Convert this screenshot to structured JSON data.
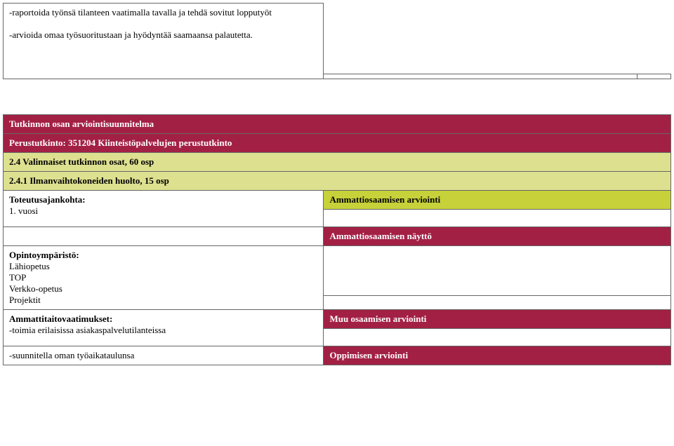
{
  "topLeft": {
    "line1": "-raportoida työnsä tilanteen vaatimalla tavalla ja tehdä sovitut lopputyöt",
    "line2": "-arvioida omaa työsuoritustaan ja hyödyntää saamaansa palautetta."
  },
  "section": {
    "header1": "Tutkinnon osan arviointisuunnitelma",
    "header2": "Perustutkinto: 351204 Kiinteistöpalvelujen  perustutkinto",
    "row1": "2.4 Valinnaiset tutkinnon osat, 60 osp",
    "row2": "2.4.1 Ilmanvaihtokoneiden huolto, 15 osp",
    "toteutusLabel": "Toteutusajankohta:",
    "toteutusValue": "1. vuosi",
    "ammattiOsa": "Ammattiosaamisen arviointi",
    "ammattiNaytto": "Ammattiosaamisen näyttö",
    "opintoLabel": "Opintoympäristö:",
    "opinto1": "Lähiopetus",
    "opinto2": "TOP",
    "opinto3": "Verkko-opetus",
    "opinto4": "Projektit",
    "ammattitaitoLabel": "Ammattitaitovaatimukset:",
    "ammattitaito1": "-toimia erilaisissa asiakaspalvelutilanteissa",
    "ammattitaito2": "-suunnitella oman työaikataulunsa",
    "muuOsa": "Muu osaamisen arviointi",
    "oppimisen": "Oppimisen arviointi"
  }
}
